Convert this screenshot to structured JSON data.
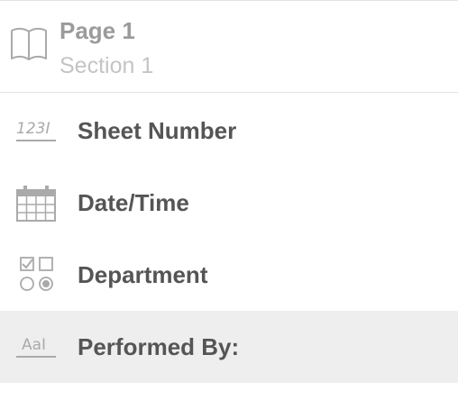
{
  "header": {
    "icon": "book-icon",
    "page_title": "Page 1",
    "section_title": "Section 1"
  },
  "fields": [
    {
      "icon": "number-field-icon",
      "icon_text": "123I",
      "label": "Sheet Number",
      "selected": false
    },
    {
      "icon": "calendar-icon",
      "label": "Date/Time",
      "selected": false
    },
    {
      "icon": "choice-field-icon",
      "label": "Department",
      "selected": false
    },
    {
      "icon": "text-field-icon",
      "icon_text": "AaI",
      "label": "Performed By:",
      "selected": true
    }
  ],
  "colors": {
    "icon_gray": "#aaaaaa",
    "label_gray": "#555555",
    "selected_row": "#eeeeee",
    "divider": "#e3e3e3"
  }
}
